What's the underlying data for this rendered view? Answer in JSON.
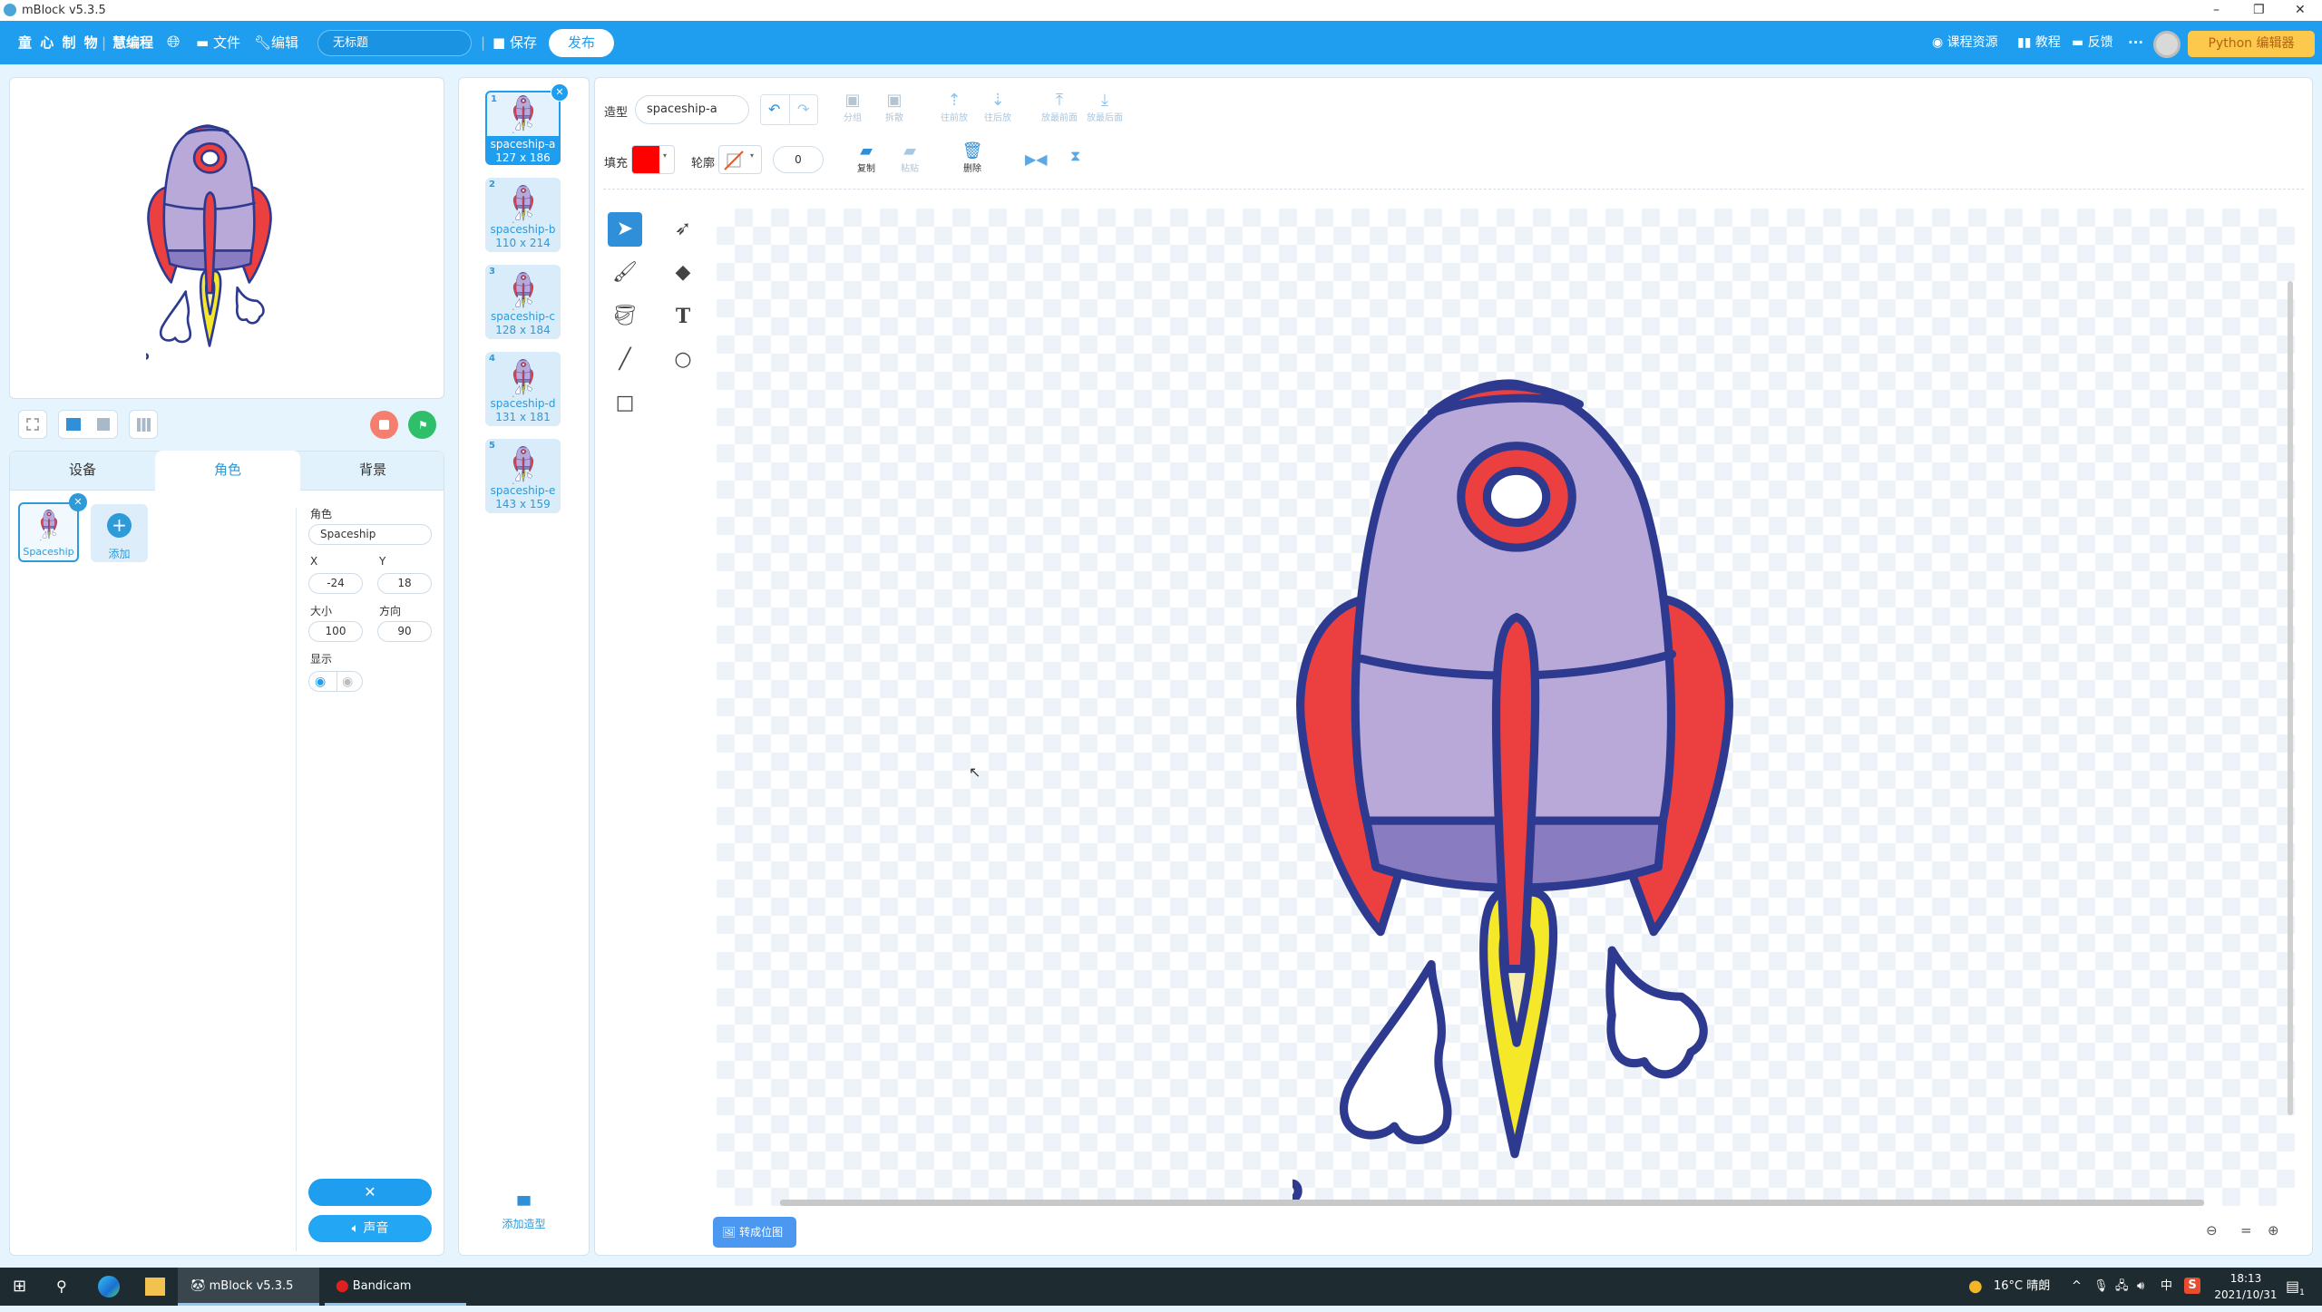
{
  "window": {
    "title": "mBlock v5.3.5",
    "controls": [
      "–",
      "❐",
      "✕"
    ]
  },
  "menubar": {
    "brand": "童 心 制 物",
    "sub_brand": "慧编程",
    "file": "文件",
    "edit": "编辑",
    "project_name": "无标题",
    "save": "保存",
    "publish": "发布",
    "course": "课程资源",
    "tutorial": "教程",
    "feedback": "反馈",
    "more": "···",
    "python": "Python 编辑器"
  },
  "stage": {
    "controls": [
      "fullscreen",
      "small-stage",
      "large-stage",
      "grid"
    ]
  },
  "tabs": [
    {
      "label": "设备"
    },
    {
      "label": "角色",
      "active": true
    },
    {
      "label": "背景"
    }
  ],
  "sprites": {
    "items": [
      {
        "name": "Spaceship"
      }
    ],
    "add_label": "添加"
  },
  "sprite_props": {
    "label_name": "角色",
    "name": "Spaceship",
    "label_x": "X",
    "x": "-24",
    "label_y": "Y",
    "y": "18",
    "label_size": "大小",
    "size": "100",
    "label_dir": "方向",
    "direction": "90",
    "label_show": "显示"
  },
  "bottom_buttons": {
    "close": "✕",
    "sound": "声音"
  },
  "costumes": {
    "items": [
      {
        "index": "1",
        "name": "spaceship-a",
        "size": "127 x 186",
        "selected": true
      },
      {
        "index": "2",
        "name": "spaceship-b",
        "size": "110 x 214"
      },
      {
        "index": "3",
        "name": "spaceship-c",
        "size": "128 x 184"
      },
      {
        "index": "4",
        "name": "spaceship-d",
        "size": "131 x 181"
      },
      {
        "index": "5",
        "name": "spaceship-e",
        "size": "143 x 159"
      }
    ],
    "add_label": "添加造型"
  },
  "editor": {
    "costume_label": "造型",
    "costume_name": "spaceship-a",
    "fill_label": "填充",
    "fill_color": "#ff0000",
    "outline_label": "轮廓",
    "outline_width": "0",
    "toolbar": {
      "group": "分组",
      "ungroup": "拆散",
      "forward": "往前放",
      "backward": "往后放",
      "front": "放最前面",
      "back": "放最后面",
      "copy": "复制",
      "paste": "粘贴",
      "delete": "删除"
    },
    "convert_bitmap": "转成位图",
    "zoom_reset": "="
  },
  "taskbar": {
    "apps": [
      {
        "label": "mBlock v5.3.5"
      },
      {
        "label": "Bandicam"
      }
    ],
    "weather": "16°C 晴朗",
    "ime": "中",
    "time": "18:13",
    "date": "2021/10/31",
    "notifications": "1"
  },
  "colors": {
    "accent": "#1f9ef0",
    "python_button": "#fcc94c",
    "stop": "#f47f6f",
    "go": "#2fbe6a"
  }
}
